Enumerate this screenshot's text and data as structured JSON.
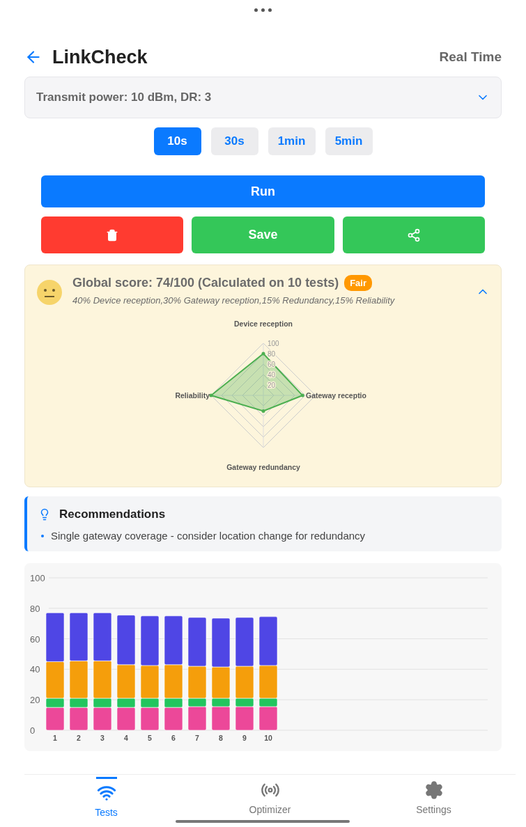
{
  "header": {
    "title": "LinkCheck",
    "mode": "Real Time"
  },
  "config_dropdown": {
    "value": "Transmit power: 10 dBm, DR: 3",
    "expanded": false
  },
  "durations": [
    {
      "label": "10s",
      "selected": true
    },
    {
      "label": "30s",
      "selected": false
    },
    {
      "label": "1min",
      "selected": false
    },
    {
      "label": "5min",
      "selected": false
    }
  ],
  "run_button": "Run",
  "actions": [
    {
      "kind": "delete"
    },
    {
      "kind": "save",
      "label": "Save"
    },
    {
      "kind": "share"
    }
  ],
  "score_card": {
    "title": "Global score: 74/100 (Calculated on 10 tests)",
    "badge": "Fair",
    "weights": "40% Device reception,30% Gateway reception,15% Redundancy,15% Reliability",
    "expanded": true,
    "chart_data": {
      "type": "radar",
      "grid": true,
      "categories": [
        "Device reception",
        "Gateway receptio",
        "Gateway redundancy",
        "Reliability"
      ],
      "ylim": [
        0,
        100
      ],
      "yticks": [
        20,
        40,
        60,
        80,
        100
      ],
      "series": [
        {
          "color": "#4caf50",
          "values": [
            80,
            75,
            30,
            100
          ]
        }
      ]
    }
  },
  "recommendations": {
    "title": "Recommendations",
    "items": [
      "Single gateway coverage - consider location change for redundancy"
    ]
  },
  "history_chart": {
    "chart_data": {
      "type": "bar",
      "stacked": true,
      "grid": true,
      "categories": [
        "1",
        "2",
        "3",
        "4",
        "5",
        "6",
        "7",
        "8",
        "9",
        "10"
      ],
      "ylim": [
        0,
        100
      ],
      "yticks": [
        0,
        20,
        40,
        60,
        80,
        100
      ],
      "series": [
        {
          "color": "#ec4899",
          "values": [
            15,
            15,
            15,
            15,
            15,
            15,
            15.5,
            15.5,
            15.5,
            15.5
          ]
        },
        {
          "color": "#22c55e",
          "values": [
            6,
            6,
            6,
            6,
            6,
            6,
            5.5,
            5.5,
            5.5,
            5.5
          ]
        },
        {
          "color": "#f59e0b",
          "values": [
            24,
            24.5,
            24.5,
            22,
            21.5,
            22,
            21,
            20.5,
            21,
            21.5
          ]
        },
        {
          "color": "#4f46e5",
          "values": [
            32,
            31.5,
            31.5,
            32.5,
            32.5,
            32,
            32,
            32,
            32,
            32
          ]
        }
      ]
    }
  },
  "bottom_nav": [
    {
      "label": "Tests",
      "selected": true
    },
    {
      "label": "Optimizer",
      "selected": false
    },
    {
      "label": "Settings",
      "selected": false
    }
  ]
}
